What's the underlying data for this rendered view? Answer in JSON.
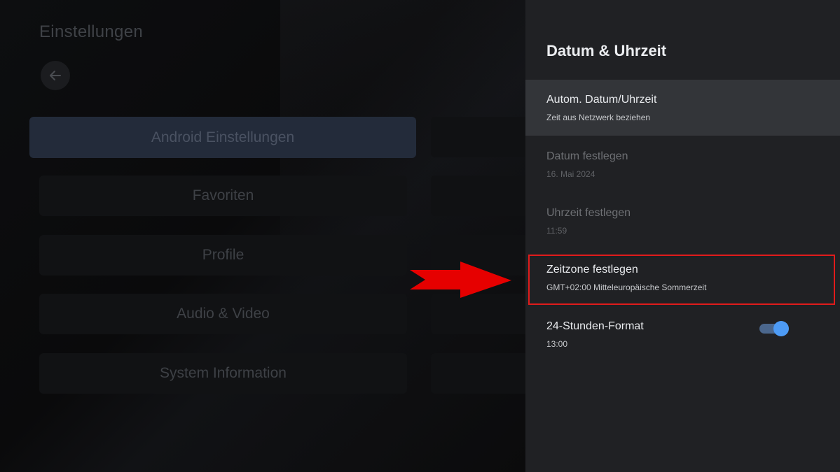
{
  "background": {
    "title": "Einstellungen",
    "back_icon": "arrow-left-icon",
    "menu": [
      {
        "label": "Android Einstellungen",
        "selected": true
      },
      {
        "label": "Favoriten"
      },
      {
        "label": "Profile"
      },
      {
        "label": "Audio & Video"
      },
      {
        "label": "System Information"
      }
    ]
  },
  "panel": {
    "title": "Datum & Uhrzeit",
    "rows": [
      {
        "primary": "Autom. Datum/Uhrzeit",
        "secondary": "Zeit aus Netzwerk beziehen",
        "focused": true
      },
      {
        "primary": "Datum festlegen",
        "secondary": "16. Mai 2024",
        "disabled": true
      },
      {
        "primary": "Uhrzeit festlegen",
        "secondary": "11:59",
        "disabled": true
      },
      {
        "primary": "Zeitzone festlegen",
        "secondary": "GMT+02:00 Mitteleuropäische Sommerzeit",
        "highlighted": true
      },
      {
        "primary": "24-Stunden-Format",
        "secondary": "13:00",
        "toggle_on": true
      }
    ]
  },
  "colors": {
    "highlight": "#e01b1b",
    "arrow": "#e60000",
    "toggle_accent": "#4d9bf5"
  },
  "annotation_icon": "red-arrow-icon"
}
